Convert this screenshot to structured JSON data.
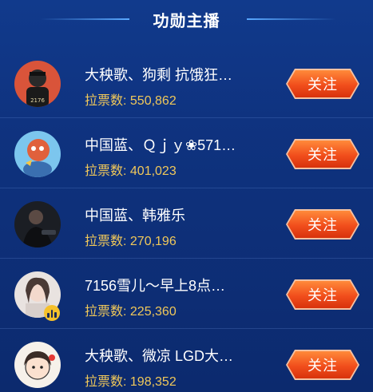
{
  "header": {
    "title": "功勋主播"
  },
  "anchors": [
    {
      "name": "大秧歌、狗剩 抗饿狂…",
      "votes": "拉票数: 550,862",
      "follow_label": "关注"
    },
    {
      "name": "中国蓝、Ｑｊｙ❀571…",
      "votes": "拉票数: 401,023",
      "follow_label": "关注"
    },
    {
      "name": "中国蓝、韩雅乐",
      "votes": "拉票数: 270,196",
      "follow_label": "关注"
    },
    {
      "name": "7156雪儿～早上8点…",
      "votes": "拉票数: 225,360",
      "follow_label": "关注"
    },
    {
      "name": "大秧歌、微凉 LGD大…",
      "votes": "拉票数: 198,352",
      "follow_label": "关注"
    }
  ],
  "colors": {
    "vote_text": "#f0c85a",
    "follow_button": "#f14e1c",
    "background": "#0c2a6e"
  }
}
